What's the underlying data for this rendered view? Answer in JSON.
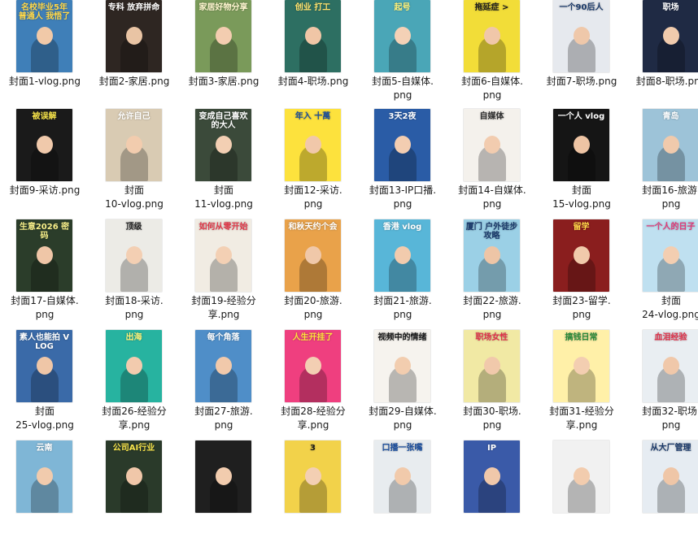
{
  "items": [
    {
      "label": "封面1-vlog.png",
      "thumb_text": "名校毕业5年 普通人 我悟了",
      "bg": "#3f7fb8",
      "fg": "#ffd84a",
      "skin": "#f1c9a8"
    },
    {
      "label": "封面2-家居.png",
      "thumb_text": "专科 放弃拼命",
      "bg": "#2e2622",
      "fg": "#ffffff",
      "skin": "#e9c4a4"
    },
    {
      "label": "封面3-家居.png",
      "thumb_text": "家居好物分享",
      "bg": "#7a9a5a",
      "fg": "#fff5d0",
      "skin": "#f3cdb0"
    },
    {
      "label": "封面4-职场.png",
      "thumb_text": "创业 打工",
      "bg": "#2d6f62",
      "fg": "#ffe36e",
      "skin": "#f0c6a6"
    },
    {
      "label": "封面5-自媒体.\npng",
      "thumb_text": "起号",
      "bg": "#4aa6b7",
      "fg": "#fff27a",
      "skin": "#f4d1b6"
    },
    {
      "label": "封面6-自媒体.\npng",
      "thumb_text": "拖延症 >",
      "bg": "#f2dd38",
      "fg": "#1c1c1c",
      "skin": "#f0c7a9"
    },
    {
      "label": "封面7-职场.png",
      "thumb_text": "一个90后人",
      "bg": "#e6e9ee",
      "fg": "#1b3a6b",
      "skin": "#efc8aa"
    },
    {
      "label": "封面8-职场.png",
      "thumb_text": "职场",
      "bg": "#1f2a44",
      "fg": "#ffffff",
      "skin": "#f1cbad"
    },
    {
      "label": "封面9-采访.png",
      "thumb_text": "被误解",
      "bg": "#1a1a1a",
      "fg": "#f6e34b",
      "skin": "#f0c9ab"
    },
    {
      "label": "封面\n10-vlog.png",
      "thumb_text": "允许自己",
      "bg": "#d9cbb3",
      "fg": "#ffffff",
      "skin": "#f2ccae"
    },
    {
      "label": "封面\n11-vlog.png",
      "thumb_text": "变成自己喜欢的大人",
      "bg": "#3b4a3a",
      "fg": "#ffffff",
      "skin": "#f3cfb3"
    },
    {
      "label": "封面12-采访.\npng",
      "thumb_text": "年入 十萬",
      "bg": "#fde23d",
      "fg": "#1a4d9c",
      "skin": "#f1c8aa"
    },
    {
      "label": "封面13-IP口播.\npng",
      "thumb_text": "3天2夜",
      "bg": "#2a5ca6",
      "fg": "#ffffff",
      "skin": "#f3cdb1"
    },
    {
      "label": "封面14-自媒体.\npng",
      "thumb_text": "自媒体",
      "bg": "#f4f1ec",
      "fg": "#333333",
      "skin": "#f2ccaf"
    },
    {
      "label": "封面\n15-vlog.png",
      "thumb_text": "一个人 vlog",
      "bg": "#151515",
      "fg": "#ffffff",
      "skin": "#eec4a4"
    },
    {
      "label": "封面16-旅游.\npng",
      "thumb_text": "青岛",
      "bg": "#9dc3d8",
      "fg": "#ffffff",
      "skin": "#f0caac"
    },
    {
      "label": "封面17-自媒体.\npng",
      "thumb_text": "生意2026 密码",
      "bg": "#2b3d2a",
      "fg": "#f7ef8a",
      "skin": "#efc6a7"
    },
    {
      "label": "封面18-采访.\npng",
      "thumb_text": "顶级",
      "bg": "#ecebe6",
      "fg": "#222222",
      "skin": "#f3cfb3"
    },
    {
      "label": "封面19-经验分\n享.png",
      "thumb_text": "如何从零开始",
      "bg": "#f1ece3",
      "fg": "#e13a4a",
      "skin": "#f3d0b4"
    },
    {
      "label": "封面20-旅游.\npng",
      "thumb_text": "和秋天约个会",
      "bg": "#e9a24a",
      "fg": "#ffffff",
      "skin": "#f0c8a9"
    },
    {
      "label": "封面21-旅游.\npng",
      "thumb_text": "香港 vlog",
      "bg": "#58b6d8",
      "fg": "#ffffff",
      "skin": "#f2cbad"
    },
    {
      "label": "封面22-旅游.\npng",
      "thumb_text": "厦门 户外徒步攻略",
      "bg": "#9bd0e6",
      "fg": "#1b3a6b",
      "skin": "#eec5a6"
    },
    {
      "label": "封面23-留学.\npng",
      "thumb_text": "留学",
      "bg": "#8a1e1e",
      "fg": "#ffd84a",
      "skin": "#f1caab"
    },
    {
      "label": "封面\n24-vlog.png",
      "thumb_text": "一个人的日子",
      "bg": "#bfe0f0",
      "fg": "#e03a7a",
      "skin": "#f3ceb1"
    },
    {
      "label": "封面\n25-vlog.png",
      "thumb_text": "素人也能拍 VLOG",
      "bg": "#3a6aa8",
      "fg": "#ffffff",
      "skin": "#efc6a7"
    },
    {
      "label": "封面26-经验分\n享.png",
      "thumb_text": "出海",
      "bg": "#27b3a0",
      "fg": "#fff27a",
      "skin": "#f2cbae"
    },
    {
      "label": "封面27-旅游.\npng",
      "thumb_text": "每个角落",
      "bg": "#4f8ec8",
      "fg": "#ffffff",
      "skin": "#f1c9ab"
    },
    {
      "label": "封面28-经验分\n享.png",
      "thumb_text": "人生开挂了",
      "bg": "#ef3f7f",
      "fg": "#ffe33d",
      "skin": "#f3cfb3"
    },
    {
      "label": "封面29-自媒体.\npng",
      "thumb_text": "视频中的情绪",
      "bg": "#f6f3ee",
      "fg": "#1a1a1a",
      "skin": "#f2cdaf"
    },
    {
      "label": "封面30-职场.\npng",
      "thumb_text": "职场女性",
      "bg": "#f1e9a4",
      "fg": "#e0304a",
      "skin": "#f1c9ab"
    },
    {
      "label": "封面31-经验分\n享.png",
      "thumb_text": "搞钱日常",
      "bg": "#fff0a8",
      "fg": "#2a8a3a",
      "skin": "#f3ceb1"
    },
    {
      "label": "封面32-职场.\npng",
      "thumb_text": "血泪经验",
      "bg": "#e9eef2",
      "fg": "#e0304a",
      "skin": "#f0c8aa"
    },
    {
      "label": "",
      "thumb_text": "云南",
      "bg": "#7fb6d6",
      "fg": "#ffffff",
      "skin": "#f1cbad"
    },
    {
      "label": "",
      "thumb_text": "公司AI行业",
      "bg": "#2a3a2a",
      "fg": "#f6e34b",
      "skin": "#f0c7a9"
    },
    {
      "label": "",
      "thumb_text": "",
      "bg": "#1f1f1f",
      "fg": "#ffffff",
      "skin": "#f2ccae"
    },
    {
      "label": "",
      "thumb_text": "3",
      "bg": "#f2d24a",
      "fg": "#1a1a1a",
      "skin": "#f3cfb3"
    },
    {
      "label": "",
      "thumb_text": "口播一张嘴",
      "bg": "#e8ecef",
      "fg": "#1a4d9c",
      "skin": "#f1caab"
    },
    {
      "label": "",
      "thumb_text": "IP",
      "bg": "#3a5aa8",
      "fg": "#ffffff",
      "skin": "#f0c8aa"
    },
    {
      "label": "",
      "thumb_text": "",
      "bg": "#f1f1f1",
      "fg": "#333333",
      "skin": "#f2ccae"
    },
    {
      "label": "",
      "thumb_text": "从大厂管理",
      "bg": "#e6ecf2",
      "fg": "#1b3a6b",
      "skin": "#efc6a7"
    }
  ]
}
